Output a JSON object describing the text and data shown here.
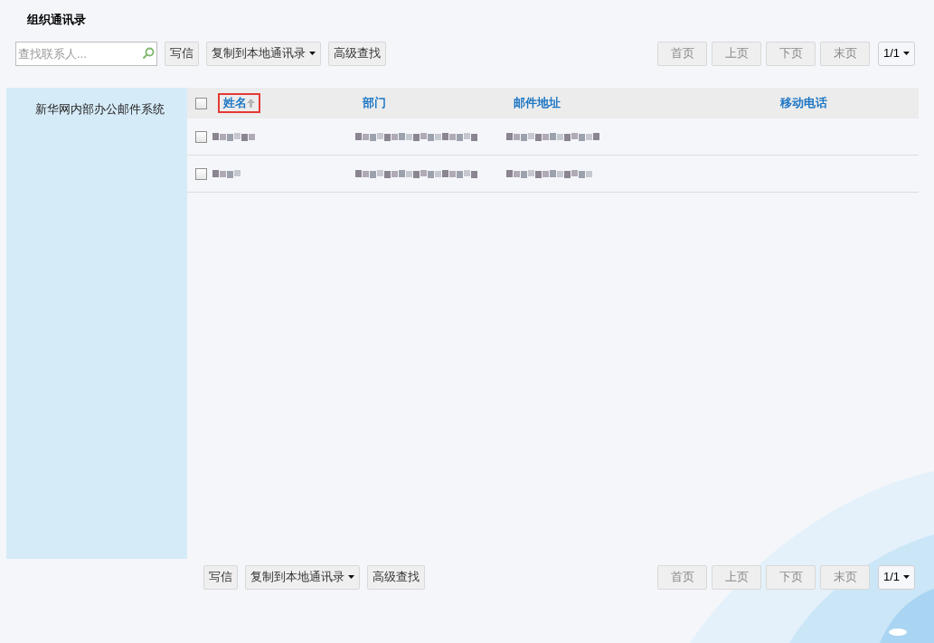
{
  "title": "组织通讯录",
  "top_toolbar": {
    "search": {
      "placeholder": "查找联系人..."
    },
    "buttons": [
      {
        "label": "写信",
        "kind": "button"
      },
      {
        "label": "复制到本地通讯录",
        "kind": "dropdown"
      },
      {
        "label": "高级查找",
        "kind": "button"
      }
    ]
  },
  "pagination_top": {
    "buttons": [
      {
        "label": "首页",
        "disabled": true
      },
      {
        "label": "上页",
        "disabled": true
      },
      {
        "label": "下页",
        "disabled": true
      },
      {
        "label": "末页",
        "disabled": true
      }
    ],
    "page": "1/1"
  },
  "sidebar": {
    "items": [
      {
        "label": "新华网内部办公邮件系统",
        "selected": true
      }
    ]
  },
  "table": {
    "select_all": {
      "checked": false
    },
    "columns": [
      {
        "label": "姓名",
        "sorted": true
      },
      {
        "label": "部门",
        "sorted": false
      },
      {
        "label": "邮件地址",
        "sorted": false
      },
      {
        "label": "移动电话",
        "sorted": false
      }
    ],
    "rows": [
      {
        "checked": false
      },
      {
        "checked": false
      }
    ]
  },
  "bottom_toolbar": {
    "buttons": [
      {
        "label": "写信",
        "kind": "button"
      },
      {
        "label": "复制到本地通讯录",
        "kind": "dropdown"
      },
      {
        "label": "高级查找",
        "kind": "button"
      }
    ]
  },
  "pagination_bottom": {
    "buttons": [
      {
        "label": "首页",
        "disabled": true
      },
      {
        "label": "上页",
        "disabled": true
      },
      {
        "label": "下页",
        "disabled": true
      },
      {
        "label": "末页",
        "disabled": true
      }
    ],
    "page": "1/1"
  }
}
